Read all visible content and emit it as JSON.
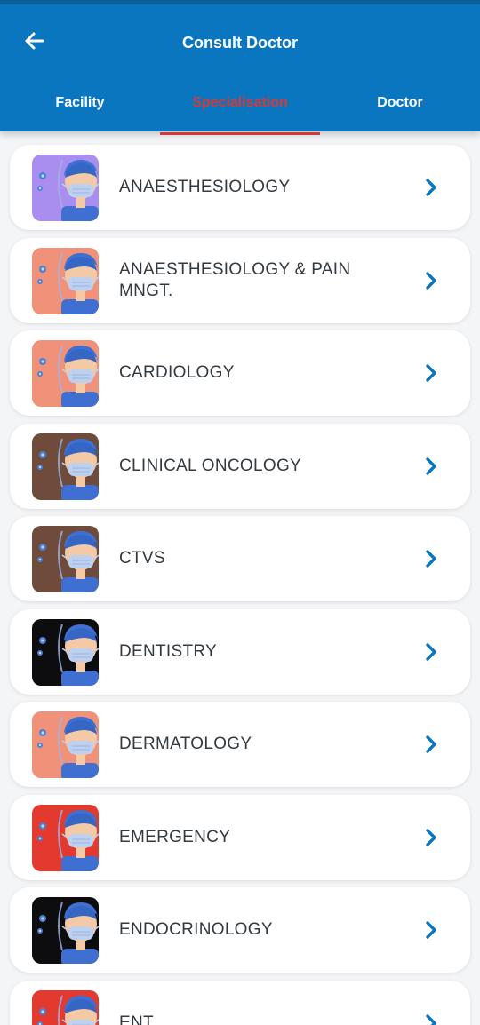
{
  "header": {
    "title": "Consult Doctor",
    "back_icon": "arrow-left-icon"
  },
  "tabs": [
    {
      "label": "Facility",
      "active": false
    },
    {
      "label": "Specialisation",
      "active": true
    },
    {
      "label": "Doctor",
      "active": false
    }
  ],
  "colors": {
    "primary": "#0a76c0",
    "active_tab": "#d23a3a",
    "chevron": "#0a76c0"
  },
  "specialisations": [
    {
      "label": "ANAESTHESIOLOGY",
      "icon": "doctor-avatar-icon",
      "bg": "#a98ef0"
    },
    {
      "label": "ANAESTHESIOLOGY & PAIN MNGT.",
      "icon": "doctor-avatar-icon",
      "bg": "#f0917a"
    },
    {
      "label": "CARDIOLOGY",
      "icon": "doctor-avatar-icon",
      "bg": "#f0917a"
    },
    {
      "label": "CLINICAL ONCOLOGY",
      "icon": "doctor-avatar-icon",
      "bg": "#6e4b3a"
    },
    {
      "label": "CTVS",
      "icon": "doctor-avatar-icon",
      "bg": "#6e4b3a"
    },
    {
      "label": "DENTISTRY",
      "icon": "doctor-avatar-icon",
      "bg": "#0d0d0f"
    },
    {
      "label": "DERMATOLOGY",
      "icon": "doctor-avatar-icon",
      "bg": "#f0917a"
    },
    {
      "label": "EMERGENCY",
      "icon": "doctor-avatar-icon",
      "bg": "#e23a2e"
    },
    {
      "label": "ENDOCRINOLOGY",
      "icon": "doctor-avatar-icon",
      "bg": "#0d0d0f"
    },
    {
      "label": "ENT",
      "icon": "doctor-avatar-icon",
      "bg": "#e23a2e"
    }
  ]
}
